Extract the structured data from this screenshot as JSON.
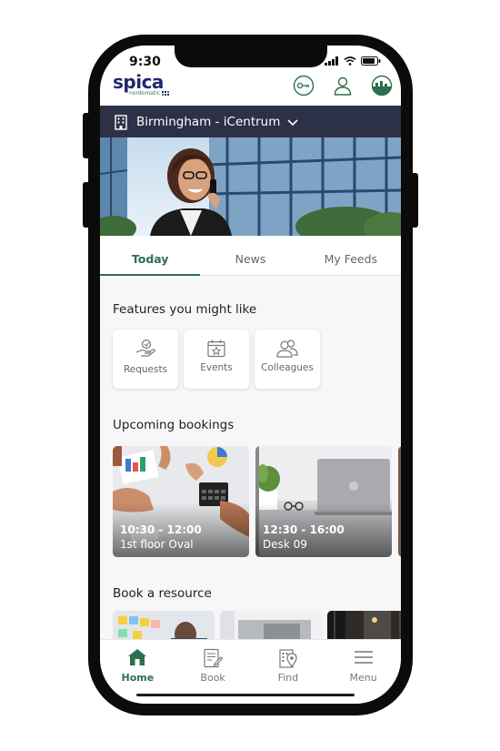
{
  "status_bar": {
    "time": "9:30"
  },
  "brand": {
    "name": "spica",
    "sub": "nordomatic"
  },
  "location": {
    "label": "Birmingham - iCentrum"
  },
  "tabs": [
    {
      "label": "Today",
      "active": true
    },
    {
      "label": "News",
      "active": false
    },
    {
      "label": "My Feeds",
      "active": false
    }
  ],
  "features": {
    "title": "Features you might like",
    "items": [
      {
        "label": "Requests",
        "icon": "hand-heart-icon"
      },
      {
        "label": "Events",
        "icon": "calendar-star-icon"
      },
      {
        "label": "Colleagues",
        "icon": "people-icon"
      }
    ]
  },
  "bookings": {
    "title": "Upcoming bookings",
    "items": [
      {
        "time": "10:30 - 12:00",
        "place": "1st floor Oval"
      },
      {
        "time": "12:30 - 16:00",
        "place": "Desk 09"
      }
    ]
  },
  "resources": {
    "title": "Book a resource"
  },
  "bottom_nav": [
    {
      "label": "Home",
      "icon": "home-icon",
      "active": true
    },
    {
      "label": "Book",
      "icon": "book-icon",
      "active": false
    },
    {
      "label": "Find",
      "icon": "map-pin-icon",
      "active": false
    },
    {
      "label": "Menu",
      "icon": "menu-icon",
      "active": false
    }
  ],
  "colors": {
    "accent": "#2e6e4e",
    "location_bar": "#2d3147",
    "brand": "#1f2a6b"
  }
}
